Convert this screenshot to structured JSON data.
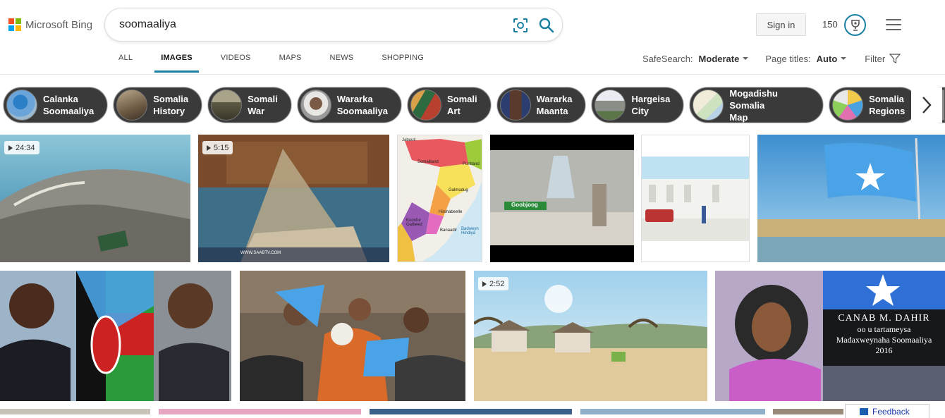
{
  "header": {
    "logo_text": "Microsoft Bing",
    "search_query": "soomaaliya",
    "sign_in_label": "Sign in",
    "rewards_points": "150"
  },
  "scopes": [
    {
      "label": "ALL",
      "active": false
    },
    {
      "label": "IMAGES",
      "active": true
    },
    {
      "label": "VIDEOS",
      "active": false
    },
    {
      "label": "MAPS",
      "active": false
    },
    {
      "label": "NEWS",
      "active": false
    },
    {
      "label": "SHOPPING",
      "active": false
    }
  ],
  "filters": {
    "safesearch_label": "SafeSearch:",
    "safesearch_value": "Moderate",
    "page_titles_label": "Page titles:",
    "page_titles_value": "Auto",
    "filter_label": "Filter"
  },
  "related_searches": [
    {
      "line1": "Calanka",
      "line2": "Soomaaliya"
    },
    {
      "line1": "Somalia",
      "line2": "History"
    },
    {
      "line1": "Somali",
      "line2": "War"
    },
    {
      "line1": "Wararka",
      "line2": "Soomaaliya"
    },
    {
      "line1": "Somali",
      "line2": "Art"
    },
    {
      "line1": "Wararka",
      "line2": "Maanta"
    },
    {
      "line1": "Hargeisa",
      "line2": "City"
    },
    {
      "line1": "Mogadishu Somalia",
      "line2": "Map"
    },
    {
      "line1": "Somalia",
      "line2": "Regions"
    }
  ],
  "image_results": {
    "row1": [
      {
        "duration": "24:34"
      },
      {
        "duration": "5:15",
        "overlay_text": "WWW.SAABTV.COM"
      },
      {
        "map_labels": [
          "Jabuuti",
          "Somaliland",
          "Puntland",
          "Galmudug",
          "Hirshabeelle",
          "Koonfur Galbeed",
          "Banaadir",
          "Badweyn Hindiya"
        ]
      },
      {
        "overlay_text": "Goobjoog"
      },
      {},
      {}
    ],
    "row2": [
      {},
      {},
      {
        "duration": "2:52"
      },
      {
        "caption_lines": [
          "CANAB M. DAHIR",
          "oo u tartameysa",
          "Madaxweynaha Soomaaliya",
          "2016"
        ]
      }
    ]
  },
  "feedback_label": "Feedback",
  "colors": {
    "accent": "#1a7fa0",
    "chip_bg": "#3a3a3a",
    "logo": [
      "#f25022",
      "#7fba00",
      "#00a4ef",
      "#ffb900"
    ]
  }
}
